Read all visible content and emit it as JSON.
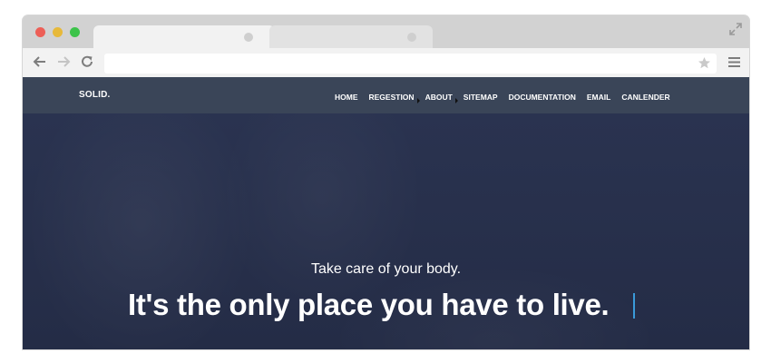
{
  "site": {
    "logo": "SOLID.",
    "nav": [
      {
        "label": "HOME",
        "caret": false
      },
      {
        "label": "REGESTION",
        "caret": true
      },
      {
        "label": "ABOUT",
        "caret": true
      },
      {
        "label": "SITEMAP",
        "caret": false
      },
      {
        "label": "DOCUMENTATION",
        "caret": false
      },
      {
        "label": "EMAIL",
        "caret": false
      },
      {
        "label": "CANLENDER",
        "caret": false
      }
    ],
    "hero": {
      "tagline": "Take care of your body.",
      "headline": "It's the only place you have to live."
    }
  },
  "browser": {
    "address_value": "",
    "icons": [
      "back-icon",
      "forward-icon",
      "reload-icon",
      "star-icon",
      "menu-icon",
      "expand-icon"
    ]
  },
  "colors": {
    "nav_bar": "#3a4558",
    "hero_bg": "#27304a",
    "cursor_accent": "#3a9ad9"
  }
}
